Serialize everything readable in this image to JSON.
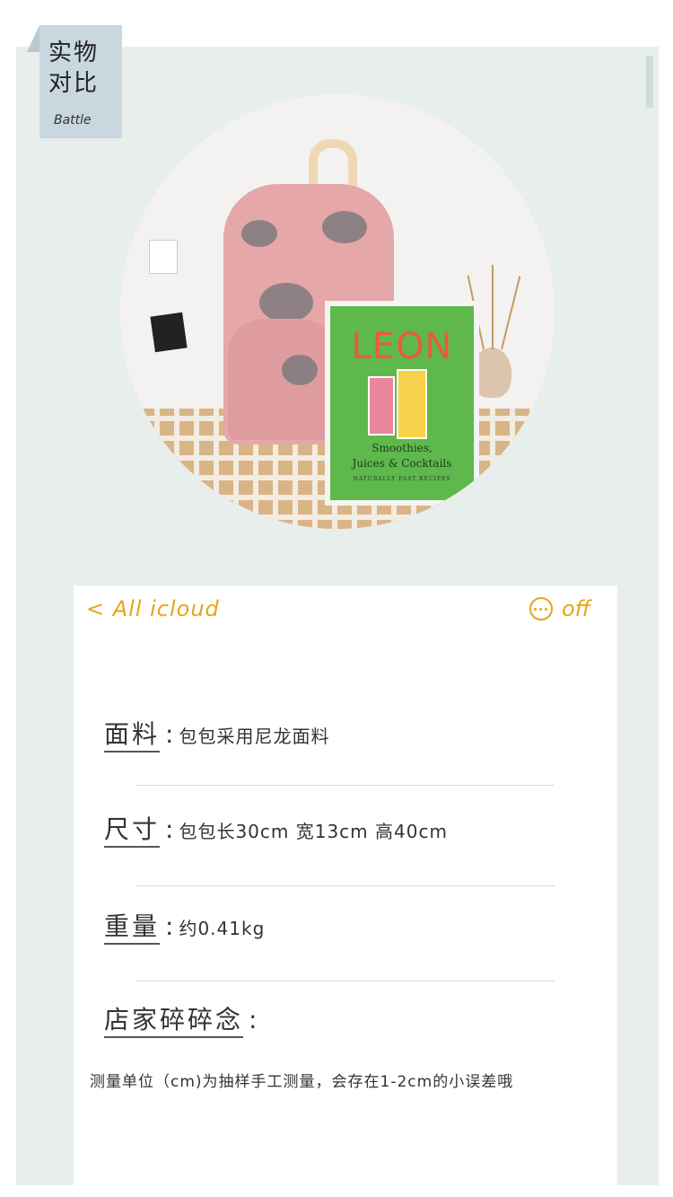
{
  "tag": {
    "title": "实物对比",
    "subtitle": "Battle"
  },
  "photo": {
    "book": {
      "title": "LEON",
      "subtitle_line1": "Smoothies,",
      "subtitle_line2": "Juices & Cocktails",
      "tagline": "NATURALLY FAST RECIPES"
    }
  },
  "card": {
    "header": {
      "back_label": "< All icloud",
      "right_label": "off",
      "right_icon": "more-dots-icon"
    },
    "specs": [
      {
        "label": "面料",
        "value": "包包采用尼龙面料"
      },
      {
        "label": "尺寸",
        "value": "包包长30cm 宽13cm 高40cm"
      },
      {
        "label": "重量",
        "value": "约0.41kg"
      },
      {
        "label": "店家碎碎念",
        "value": ""
      }
    ],
    "note": "测量单位（cm)为抽样手工测量，会存在1-2cm的小误差哦"
  },
  "colors": {
    "accent": "#e6a519",
    "panel": "#e8eeec",
    "tag": "#c9d7df"
  }
}
